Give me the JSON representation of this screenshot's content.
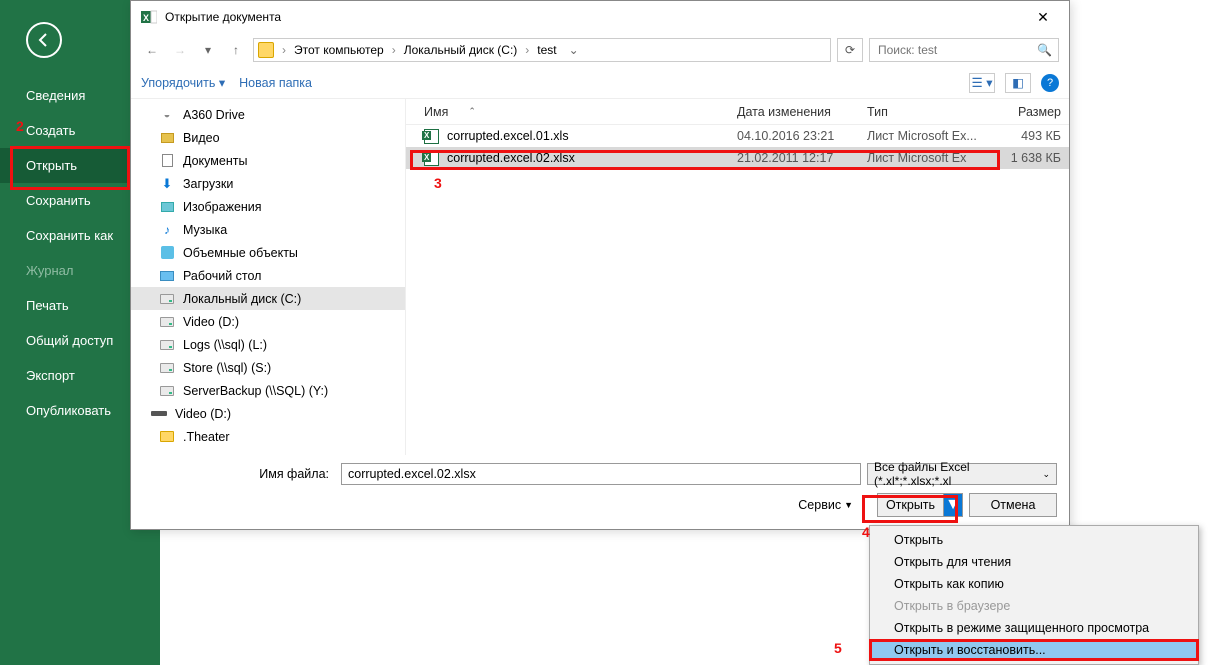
{
  "backstage": {
    "items": [
      {
        "label": "Сведения"
      },
      {
        "label": "Создать"
      },
      {
        "label": "Открыть",
        "selected": true
      },
      {
        "label": "Сохранить"
      },
      {
        "label": "Сохранить как"
      },
      {
        "label": "Журнал",
        "dim": true
      },
      {
        "label": "Печать"
      },
      {
        "label": "Общий доступ"
      },
      {
        "label": "Экспорт"
      },
      {
        "label": "Опубликовать"
      }
    ]
  },
  "dialog": {
    "title": "Открытие документа",
    "breadcrumbs": [
      "Этот компьютер",
      "Локальный диск (C:)",
      "test"
    ],
    "search_placeholder": "Поиск: test",
    "toolbar": {
      "organize": "Упорядочить",
      "newfolder": "Новая папка"
    },
    "tree": [
      {
        "label": "A360 Drive",
        "icon": "cloud"
      },
      {
        "label": "Видео",
        "icon": "vid"
      },
      {
        "label": "Документы",
        "icon": "doc"
      },
      {
        "label": "Загрузки",
        "icon": "dl"
      },
      {
        "label": "Изображения",
        "icon": "img"
      },
      {
        "label": "Музыка",
        "icon": "music"
      },
      {
        "label": "Объемные объекты",
        "icon": "3d"
      },
      {
        "label": "Рабочий стол",
        "icon": "desktop"
      },
      {
        "label": "Локальный диск (C:)",
        "icon": "drive",
        "selected": true
      },
      {
        "label": "Video (D:)",
        "icon": "drive"
      },
      {
        "label": "Logs (\\\\sql) (L:)",
        "icon": "drive"
      },
      {
        "label": "Store (\\\\sql) (S:)",
        "icon": "drive"
      },
      {
        "label": "ServerBackup (\\\\SQL) (Y:)",
        "icon": "drive"
      },
      {
        "label": "Video (D:)",
        "icon": "section",
        "head": true
      },
      {
        "label": ".Theater",
        "icon": "folder"
      }
    ],
    "columns": {
      "name": "Имя",
      "date": "Дата изменения",
      "type": "Тип",
      "size": "Размер"
    },
    "files": [
      {
        "name": "corrupted.excel.01.xls",
        "date": "04.10.2016 23:21",
        "type": "Лист Microsoft Ex...",
        "size": "493 КБ"
      },
      {
        "name": "corrupted.excel.02.xlsx",
        "date": "21.02.2011 12:17",
        "type": "Лист Microsoft Ex",
        "size": "1 638 КБ",
        "selected": true
      }
    ],
    "footer": {
      "filename_label": "Имя файла:",
      "filename_value": "corrupted.excel.02.xlsx",
      "filter": "Все файлы Excel (*.xl*;*.xlsx;*.xl",
      "tools": "Сервис",
      "open": "Открыть",
      "cancel": "Отмена"
    }
  },
  "dropdown": {
    "items": [
      {
        "label": "Открыть"
      },
      {
        "label": "Открыть для чтения"
      },
      {
        "label": "Открыть как копию"
      },
      {
        "label": "Открыть в браузере",
        "dis": true
      },
      {
        "label": "Открыть в режиме защищенного просмотра"
      },
      {
        "label": "Открыть и восстановить...",
        "selected": true
      }
    ]
  },
  "annotations": {
    "a2": "2",
    "a3": "3",
    "a4": "4",
    "a5": "5"
  }
}
